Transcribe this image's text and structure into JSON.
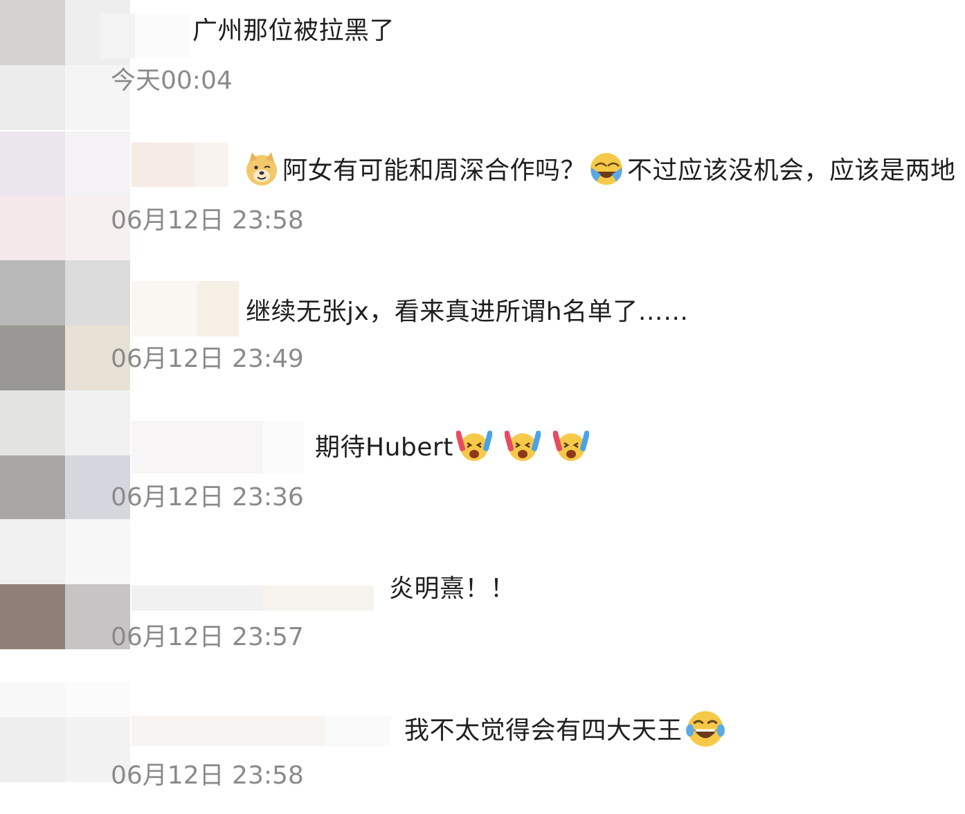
{
  "comments": [
    {
      "text_before": "广州那位被拉黑了",
      "text_after": "",
      "time": "今天00:04",
      "emojis": []
    },
    {
      "text_before": "阿女有可能和周深合作吗？",
      "text_after": "不过应该没机会，应该是两地",
      "time": "06月12日 23:58",
      "emojis": [
        "doge-icon",
        "laugh-cry-icon"
      ]
    },
    {
      "text_before": "继续无张jx，看来真进所谓h名单了……",
      "text_after": "",
      "time": "06月12日 23:49",
      "emojis": []
    },
    {
      "text_before": "期待Hubert",
      "text_after": "",
      "time": "06月12日 23:36",
      "emojis": [
        "cheer-glowstick-icon",
        "cheer-glowstick-icon",
        "cheer-glowstick-icon"
      ]
    },
    {
      "text_before": "炎明熹！！",
      "text_after": "",
      "time": "06月12日 23:57",
      "emojis": []
    },
    {
      "text_before": "我不太觉得会有四大天王",
      "text_after": "",
      "time": "06月12日 23:58",
      "emojis": [
        "tears-of-joy-icon"
      ]
    }
  ],
  "colors": {
    "text": "#1f1f1f",
    "timestamp": "#8a8a8a",
    "emoji_yellow": "#f7c948"
  }
}
